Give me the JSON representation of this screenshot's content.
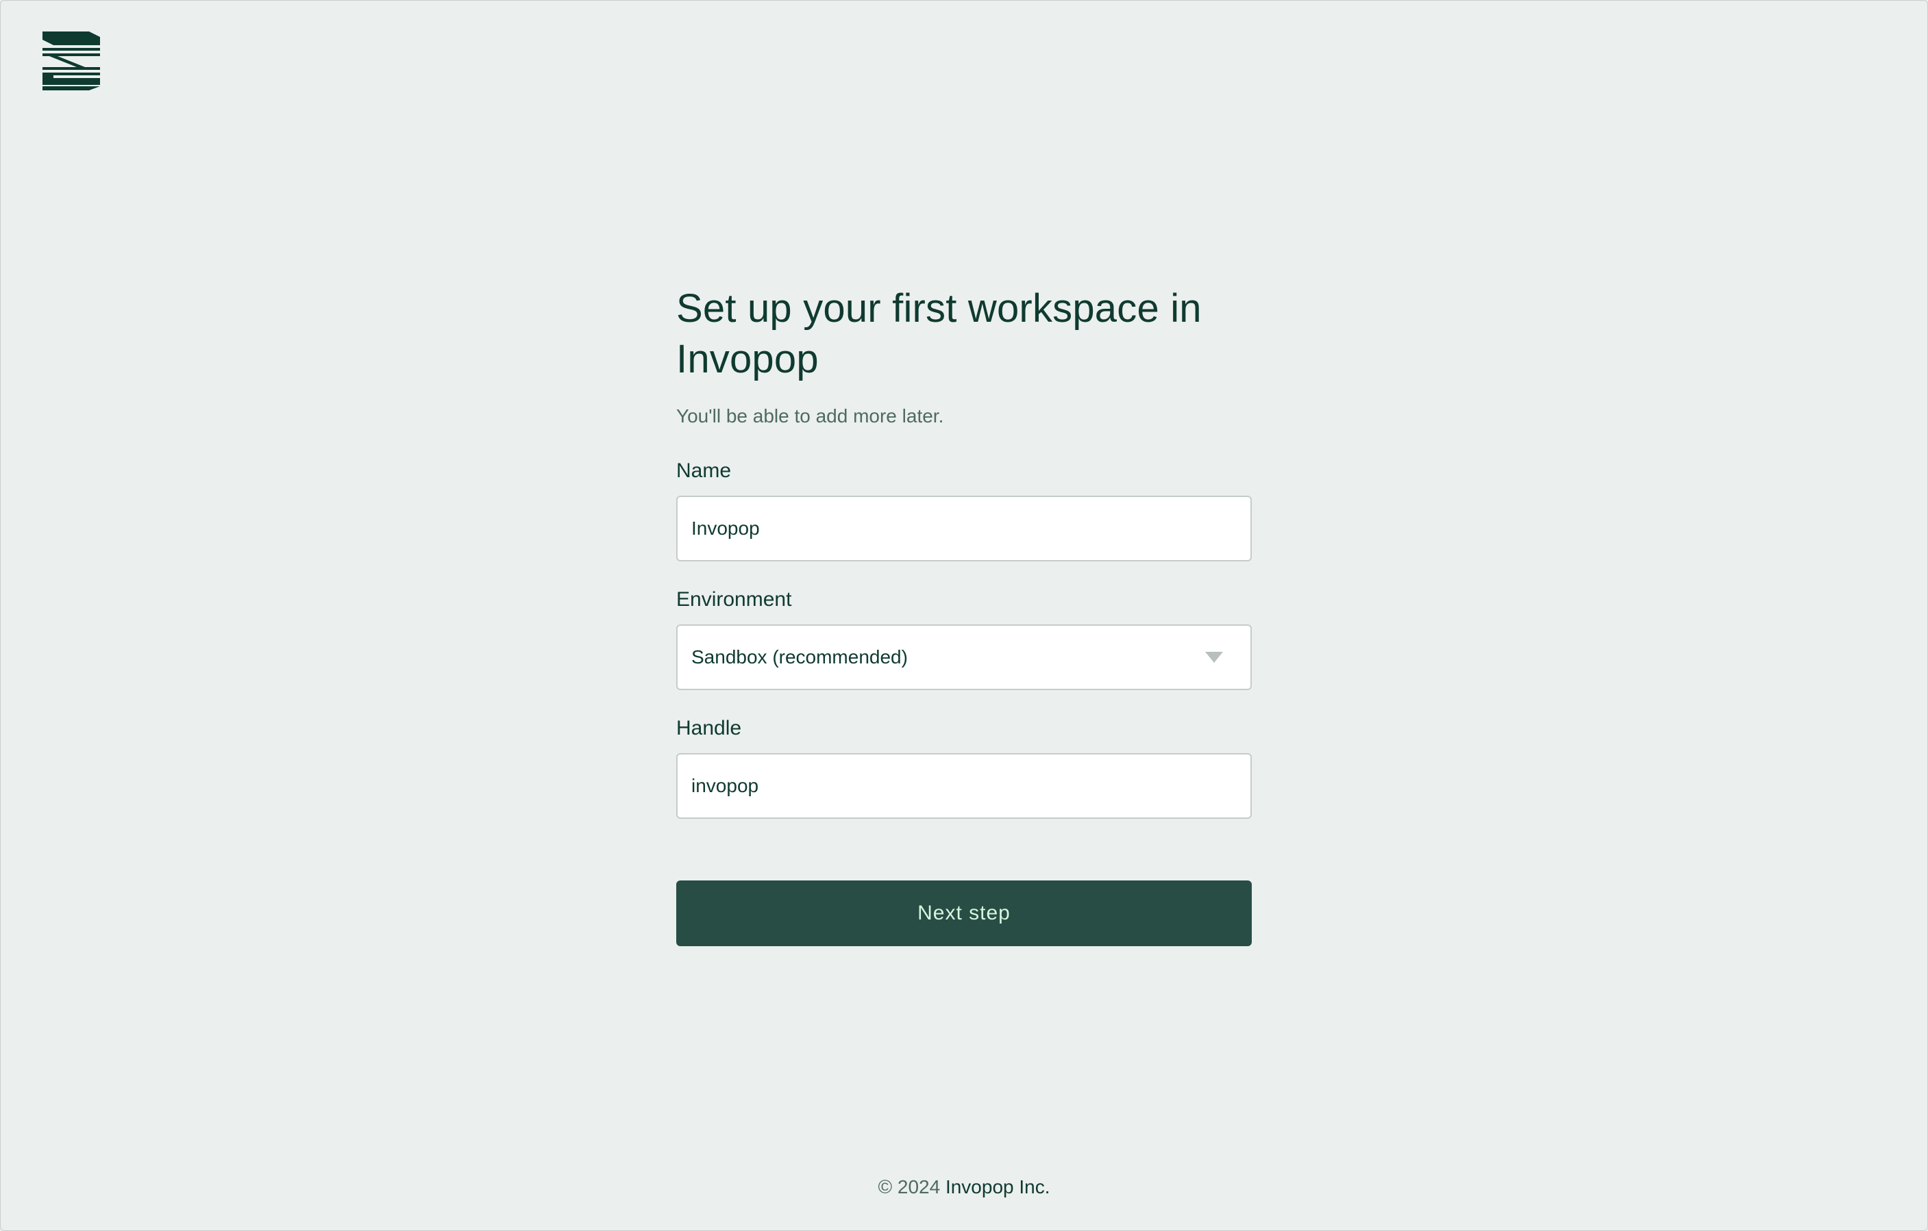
{
  "logo": {
    "icon": "invopop-logo-icon"
  },
  "heading": {
    "title": "Set up your first workspace in Invopop",
    "subtitle": "You'll be able to add more later."
  },
  "form": {
    "name": {
      "label": "Name",
      "value": "Invopop"
    },
    "environment": {
      "label": "Environment",
      "value": "Sandbox (recommended)"
    },
    "handle": {
      "label": "Handle",
      "value": "invopop"
    },
    "submit_label": "Next step"
  },
  "footer": {
    "copyright": "© 2024",
    "company": "Invopop Inc."
  },
  "colors": {
    "background": "#ebefed",
    "primary": "#274d45",
    "primary_text": "#d7f5dd",
    "text": "#0f3a30"
  }
}
